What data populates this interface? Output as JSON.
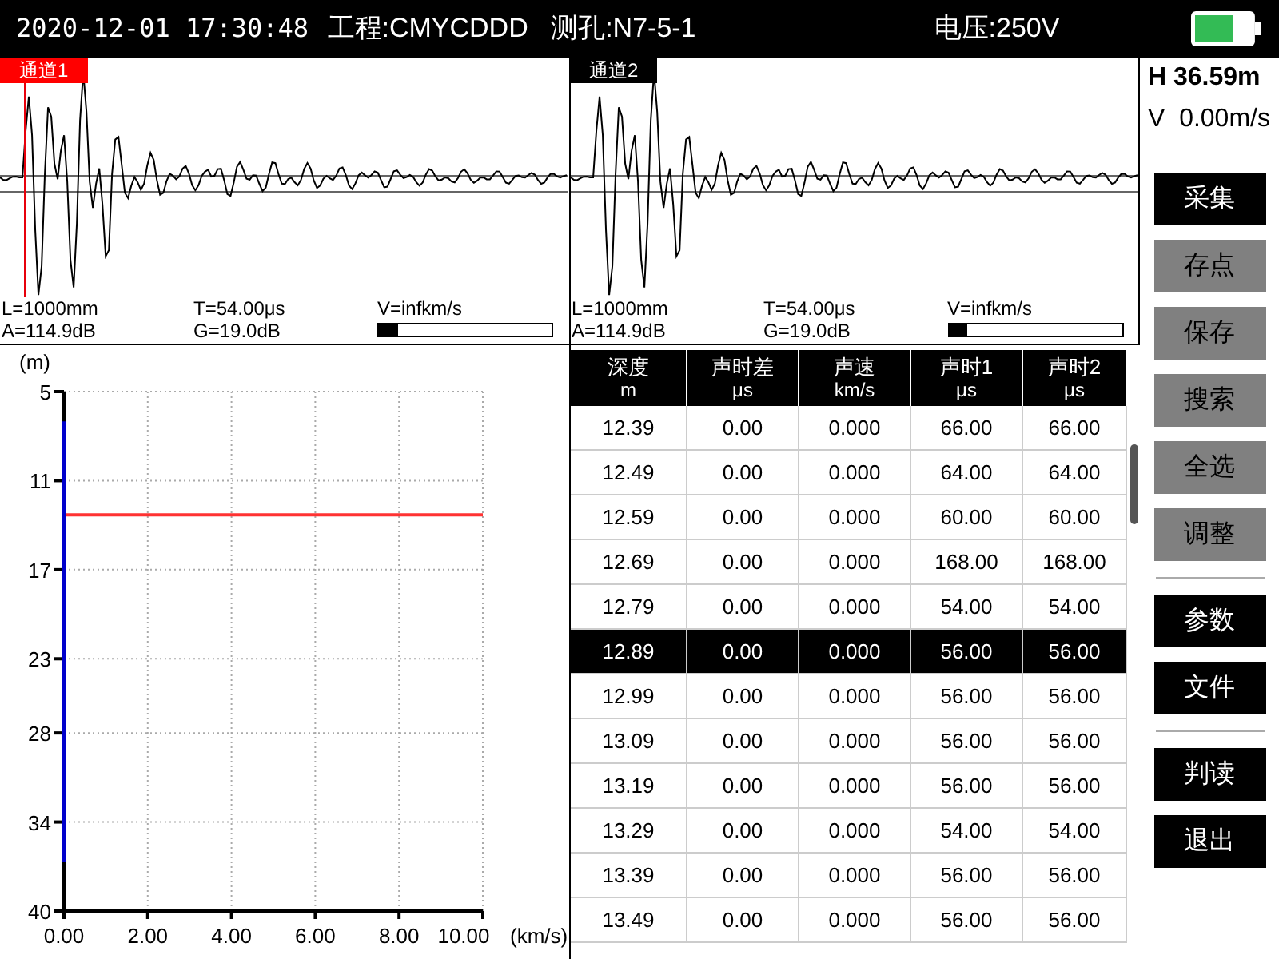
{
  "status_bar": {
    "datetime": "2020-12-01 17:30:48",
    "project": "工程:CMYCDDD",
    "hole": "测孔:N7-5-1",
    "voltage": "电压:250V"
  },
  "channels": [
    {
      "label": "通道1",
      "selected": true,
      "L": "L=1000mm",
      "T": "T=54.00μs",
      "V": "V=infkm/s",
      "A": "A=114.9dB",
      "G": "G=19.0dB",
      "level": 0.11
    },
    {
      "label": "通道2",
      "selected": false,
      "L": "L=1000mm",
      "T": "T=54.00μs",
      "V": "V=infkm/s",
      "A": "A=114.9dB",
      "G": "G=19.0dB",
      "level": 0.11
    }
  ],
  "readout": {
    "H": "H 36.59m",
    "V": "V  0.00m/s"
  },
  "buttons": [
    {
      "label": "采集",
      "disabled": false
    },
    {
      "label": "存点",
      "disabled": true
    },
    {
      "label": "保存",
      "disabled": true
    },
    {
      "label": "搜索",
      "disabled": true
    },
    {
      "label": "全选",
      "disabled": true
    },
    {
      "label": "调整",
      "disabled": true
    },
    {
      "kind": "divider"
    },
    {
      "label": "参数",
      "disabled": false
    },
    {
      "label": "文件",
      "disabled": false
    },
    {
      "kind": "divider"
    },
    {
      "label": "判读",
      "disabled": false
    },
    {
      "label": "退出",
      "disabled": false
    }
  ],
  "chart": {
    "chart_data": {
      "type": "line",
      "orientation": "horizontal",
      "grid": true,
      "ylabel": "(m)",
      "xlabel": "(km/s)",
      "xlim": [
        0,
        10
      ],
      "ylim": [
        40,
        5
      ],
      "xticks": [
        {
          "value": 0,
          "label": "0.00"
        },
        {
          "value": 2,
          "label": "2.00"
        },
        {
          "value": 4,
          "label": "4.00"
        },
        {
          "value": 6,
          "label": "6.00"
        },
        {
          "value": 8,
          "label": "8.00"
        },
        {
          "value": 10,
          "label": "10.00"
        }
      ],
      "yticks": [
        {
          "value": 5,
          "label": "5"
        },
        {
          "value": 11,
          "label": "11"
        },
        {
          "value": 17,
          "label": "17"
        },
        {
          "value": 23,
          "label": "23"
        },
        {
          "value": 28,
          "label": "28"
        },
        {
          "value": 34,
          "label": "34"
        },
        {
          "value": 40,
          "label": "40"
        }
      ],
      "series": [
        {
          "color": "#0000cc",
          "x": [
            7.0,
            36.7
          ],
          "values": [
            0,
            0
          ]
        }
      ],
      "ref_lines": [
        {
          "axis": "y",
          "value": 13.3
        }
      ]
    }
  },
  "table": {
    "columns": [
      {
        "name": "深度",
        "unit": "m"
      },
      {
        "name": "声时差",
        "unit": "μs"
      },
      {
        "name": "声速",
        "unit": "km/s"
      },
      {
        "name": "声时1",
        "unit": "μs"
      },
      {
        "name": "声时2",
        "unit": "μs"
      }
    ],
    "rows": [
      {
        "cells": [
          "12.39",
          "0.00",
          "0.000",
          "66.00",
          "66.00"
        ],
        "selected": false
      },
      {
        "cells": [
          "12.49",
          "0.00",
          "0.000",
          "64.00",
          "64.00"
        ],
        "selected": false
      },
      {
        "cells": [
          "12.59",
          "0.00",
          "0.000",
          "60.00",
          "60.00"
        ],
        "selected": false
      },
      {
        "cells": [
          "12.69",
          "0.00",
          "0.000",
          "168.00",
          "168.00"
        ],
        "selected": false
      },
      {
        "cells": [
          "12.79",
          "0.00",
          "0.000",
          "54.00",
          "54.00"
        ],
        "selected": false
      },
      {
        "cells": [
          "12.89",
          "0.00",
          "0.000",
          "56.00",
          "56.00"
        ],
        "selected": true
      },
      {
        "cells": [
          "12.99",
          "0.00",
          "0.000",
          "56.00",
          "56.00"
        ],
        "selected": false
      },
      {
        "cells": [
          "13.09",
          "0.00",
          "0.000",
          "56.00",
          "56.00"
        ],
        "selected": false
      },
      {
        "cells": [
          "13.19",
          "0.00",
          "0.000",
          "56.00",
          "56.00"
        ],
        "selected": false
      },
      {
        "cells": [
          "13.29",
          "0.00",
          "0.000",
          "54.00",
          "54.00"
        ],
        "selected": false
      },
      {
        "cells": [
          "13.39",
          "0.00",
          "0.000",
          "56.00",
          "56.00"
        ],
        "selected": false
      },
      {
        "cells": [
          "13.49",
          "0.00",
          "0.000",
          "56.00",
          "56.00"
        ],
        "selected": false
      }
    ]
  }
}
